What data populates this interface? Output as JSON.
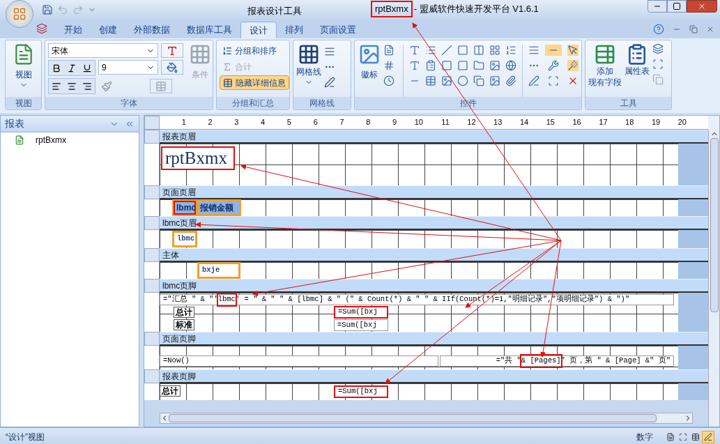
{
  "window": {
    "context_title": "报表设计工具",
    "document_name": "rptBxmx",
    "document_highlighted": true,
    "app_title": "- 盟威软件快速开发平台 V1.6.1"
  },
  "ribbon_tabs": [
    {
      "label": "开始",
      "selected": false
    },
    {
      "label": "创建",
      "selected": false
    },
    {
      "label": "外部数据",
      "selected": false
    },
    {
      "label": "数据库工具",
      "selected": false
    },
    {
      "label": "设计",
      "selected": true
    },
    {
      "label": "排列",
      "selected": false
    },
    {
      "label": "页面设置",
      "selected": false
    }
  ],
  "ribbon": {
    "view_group": {
      "title": "视图",
      "button": "视图"
    },
    "font_group": {
      "title": "字体",
      "font": "宋体",
      "size": "9",
      "conditional": "条件"
    },
    "grouping_group": {
      "title": "分组和汇总",
      "items": [
        {
          "label": "分组和排序",
          "disabled": false,
          "selected": false
        },
        {
          "label": "合计",
          "disabled": true,
          "selected": false
        },
        {
          "label": "隐藏详细信息",
          "disabled": false,
          "selected": true
        }
      ]
    },
    "gridlines_group": {
      "title": "网格线",
      "button": "网格线"
    },
    "controls_group": {
      "title": "控件",
      "logo_button": "徽标"
    },
    "tools_group": {
      "title": "工具",
      "add_fields": [
        "添加",
        "现有字段"
      ],
      "property_sheet": "属性表"
    }
  },
  "nav_pane": {
    "title": "报表",
    "items": [
      {
        "label": "rptBxmx",
        "selected": false
      }
    ]
  },
  "ruler": [
    "1",
    "2",
    "3",
    "4",
    "5",
    "6",
    "7",
    "8",
    "9",
    "10",
    "11",
    "12",
    "13",
    "14",
    "15",
    "16",
    "17",
    "18",
    "19",
    "20"
  ],
  "sections": [
    {
      "title": "报表页眉",
      "controls": [
        {
          "kind": "title",
          "text": "rptBxmx",
          "selected": false,
          "highlighted": true
        }
      ]
    },
    {
      "title": "页面页眉",
      "controls": [
        {
          "kind": "label",
          "text": "lbmc",
          "selected": true,
          "highlighted": true
        },
        {
          "kind": "label",
          "text": "报销金额",
          "selected": true,
          "highlighted": false
        }
      ]
    },
    {
      "title": "lbmc页眉",
      "controls": [
        {
          "kind": "textbox",
          "text": "lbmc",
          "selected": true,
          "highlighted": false
        }
      ]
    },
    {
      "title": "主体",
      "controls": [
        {
          "kind": "textbox",
          "text": "bxje",
          "selected": true,
          "highlighted": false
        }
      ]
    },
    {
      "title": "lbmc页脚",
      "controls": [
        {
          "kind": "formula",
          "segments": [
            {
              "text": "=\"汇总 \" & \"'",
              "highlighted": false
            },
            {
              "text": "lbmc",
              "highlighted": true
            },
            {
              "text": "' = \" & \" \" & [lbmc] & \" (\" & Count(*) & \" \" & IIf(Count(*)=1,\"明细记录\",\"项明细记录\") & \")\"",
              "highlighted": false
            }
          ]
        },
        {
          "kind": "label",
          "text": "总计",
          "selected": false,
          "highlighted": false
        },
        {
          "kind": "textbox",
          "text": "=Sum([bxj",
          "selected": false,
          "highlighted": true
        },
        {
          "kind": "label",
          "text": "标准",
          "selected": false,
          "highlighted": false
        },
        {
          "kind": "textbox",
          "text": "=Sum([bxj",
          "selected": false,
          "highlighted": false
        }
      ]
    },
    {
      "title": "页面页脚",
      "controls": [
        {
          "kind": "textbox",
          "text": "=Now()",
          "selected": false,
          "highlighted": false
        },
        {
          "kind": "formula",
          "segments": [
            {
              "text": "=\"共 \" ",
              "highlighted": false
            },
            {
              "text": "& [Pages]",
              "highlighted": true
            },
            {
              "text": " \" 页，第 \" & [Page] &\" 页\"",
              "highlighted": false
            }
          ]
        }
      ]
    },
    {
      "title": "报表页脚",
      "controls": [
        {
          "kind": "label",
          "text": "总计",
          "selected": false,
          "highlighted": false
        },
        {
          "kind": "textbox",
          "text": "=Sum([bxj",
          "selected": false,
          "highlighted": true
        }
      ]
    }
  ],
  "status_bar": {
    "view": "“设计”视图",
    "mode": "数字",
    "views": [
      {
        "selected": false
      },
      {
        "selected": false
      },
      {
        "selected": false
      },
      {
        "selected": true
      }
    ]
  }
}
